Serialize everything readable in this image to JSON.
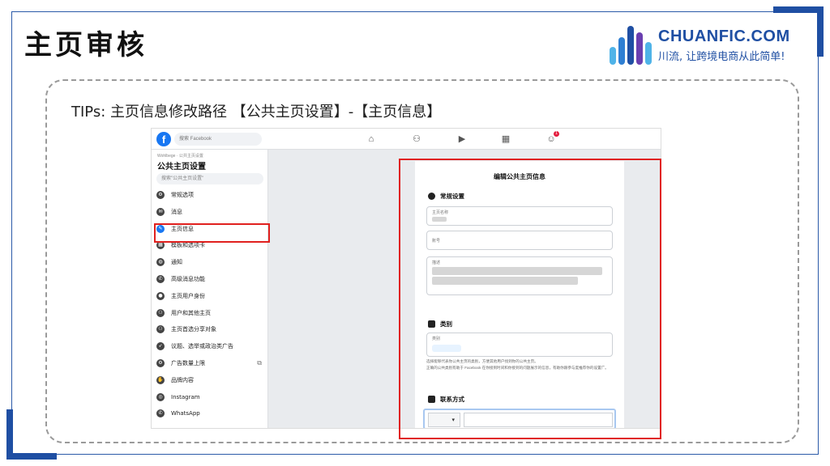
{
  "slide": {
    "title": "主页审核",
    "tips": "TIPs: 主页信息修改路径 【公共主页设置】-【主页信息】"
  },
  "logo": {
    "brand": "CHUANFIC.COM",
    "slogan": "川流, 让跨境电商从此简单!",
    "bar_colors": [
      "#4fb3e8",
      "#2f7fd3",
      "#1f4fa3",
      "#6a3fb0",
      "#4fb3e8"
    ]
  },
  "screenshot": {
    "topbar": {
      "logo_letter": "f",
      "search_placeholder": "搜索 Facebook",
      "nav_icons": [
        "home-icon",
        "friends-icon",
        "watch-icon",
        "marketplace-icon",
        "groups-icon"
      ],
      "notification_count": "1"
    },
    "sidebar": {
      "breadcrumb": "Wohlbege · 公共主页设置",
      "title": "公共主页设置",
      "search_placeholder": "搜索\"公共主页设置\"",
      "items": [
        {
          "label": "常规选项",
          "icon": "gear-icon"
        },
        {
          "label": "消息",
          "icon": "chat-icon"
        },
        {
          "label": "主页信息",
          "icon": "pencil-icon",
          "active": true
        },
        {
          "label": "模板和选项卡",
          "icon": "grid-icon"
        },
        {
          "label": "通知",
          "icon": "globe-icon"
        },
        {
          "label": "高级消息功能",
          "icon": "messenger-icon"
        },
        {
          "label": "主页用户身份",
          "icon": "person-icon"
        },
        {
          "label": "用户和其他主页",
          "icon": "people-icon"
        },
        {
          "label": "主页首选分享对象",
          "icon": "people-icon"
        },
        {
          "label": "议题、选举或政治类广告",
          "icon": "rocket-icon"
        },
        {
          "label": "广告数量上限",
          "icon": "gear-icon",
          "external": true
        },
        {
          "label": "品牌内容",
          "icon": "handshake-icon"
        },
        {
          "label": "Instagram",
          "icon": "instagram-icon"
        },
        {
          "label": "WhatsApp",
          "icon": "whatsapp-icon"
        }
      ]
    },
    "panel": {
      "title": "编辑公共主页信息",
      "general_section": "常规设置",
      "name_label": "主页名称",
      "username_label": "账号",
      "description_label": "描述",
      "category_section": "类别",
      "category_label": "类别",
      "category_note_1": "选择能够代表你公共主页的类别，方便其他用户找到你的公共主页。",
      "category_note_2": "正确的公共类别有助于 Facebook 在你接到时间和你接到的问题展示的信息，有助你跟参与度推荐你的设置广。",
      "contact_section": "联系方式"
    }
  }
}
